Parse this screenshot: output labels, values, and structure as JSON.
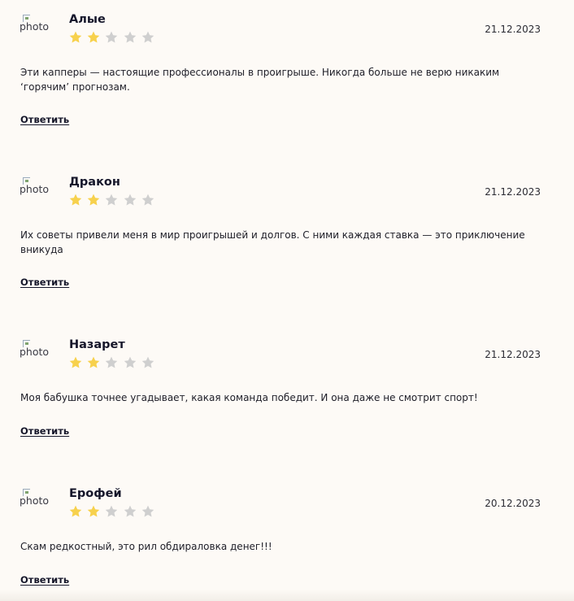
{
  "colors": {
    "background": "#fdfaf6",
    "star_filled": "#f7d14d",
    "star_empty": "#cfcfcf"
  },
  "reviews": [
    {
      "photo_alt": "photo",
      "name": "Алые",
      "rating": 2,
      "max_rating": 5,
      "date": "21.12.2023",
      "text": "Эти капперы — настоящие профессионалы в проигрыше. Никогда больше не верю никаким ‘горячим’ прогнозам.",
      "reply_label": "Ответить"
    },
    {
      "photo_alt": "photo",
      "name": "Дракон",
      "rating": 2,
      "max_rating": 5,
      "date": "21.12.2023",
      "text": "Их советы привели меня в мир проигрышей и долгов. С ними каждая ставка — это приключение вникуда",
      "reply_label": "Ответить"
    },
    {
      "photo_alt": "photo",
      "name": "Назарет",
      "rating": 2,
      "max_rating": 5,
      "date": "21.12.2023",
      "text": "Моя бабушка точнее угадывает, какая команда победит. И она даже не смотрит спорт!",
      "reply_label": "Ответить"
    },
    {
      "photo_alt": "photo",
      "name": "Ерофей",
      "rating": 2,
      "max_rating": 5,
      "date": "20.12.2023",
      "text": "Скам редкостный, это рил обдираловка денег!!!",
      "reply_label": "Ответить"
    }
  ]
}
